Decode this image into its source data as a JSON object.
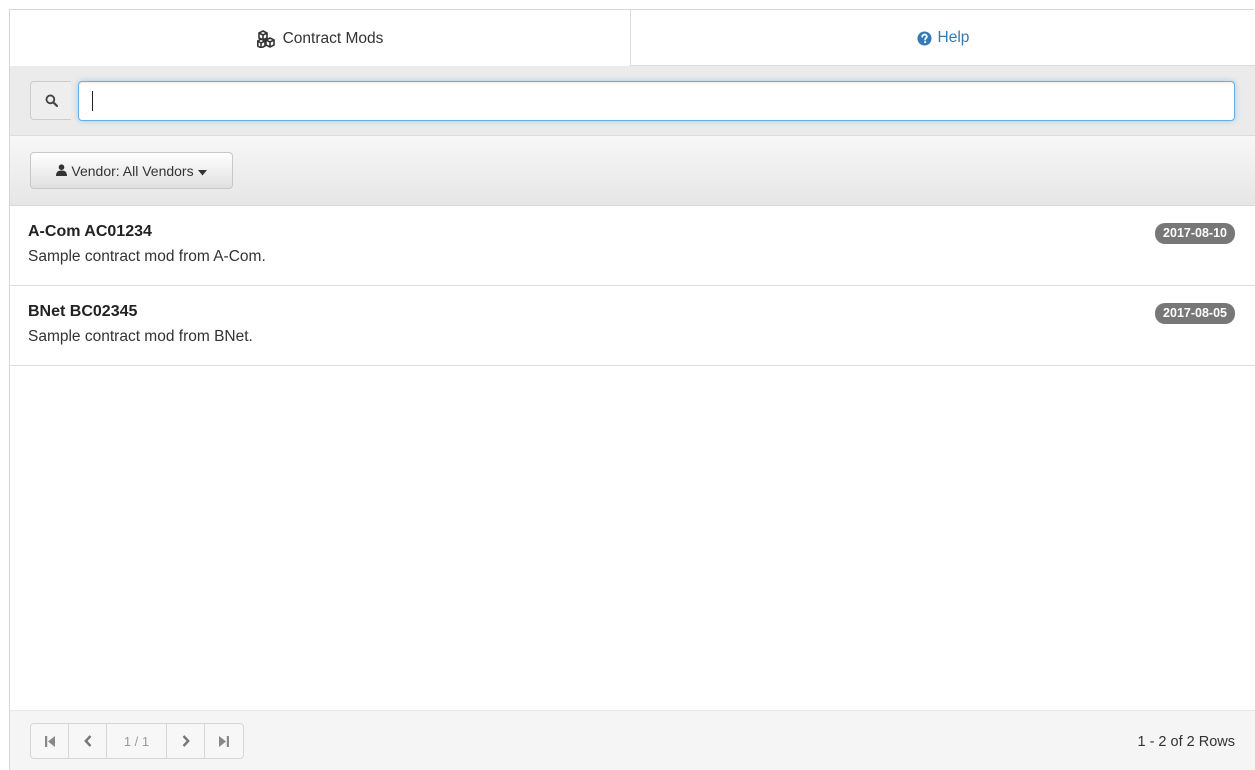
{
  "tabs": {
    "contract_mods": "Contract Mods",
    "help": "Help"
  },
  "search": {
    "value": "",
    "placeholder": ""
  },
  "filter": {
    "vendor_label": "Vendor: All Vendors"
  },
  "items": [
    {
      "title": "A-Com AC01234",
      "description": "Sample contract mod from A-Com.",
      "date": "2017-08-10"
    },
    {
      "title": "BNet BC02345",
      "description": "Sample contract mod from BNet.",
      "date": "2017-08-05"
    }
  ],
  "pager": {
    "page": "1 / 1",
    "rows_info": "1 - 2 of 2 Rows"
  },
  "colors": {
    "accent": "#337ab7",
    "badge": "#777777",
    "focus_border": "#66afe9"
  }
}
